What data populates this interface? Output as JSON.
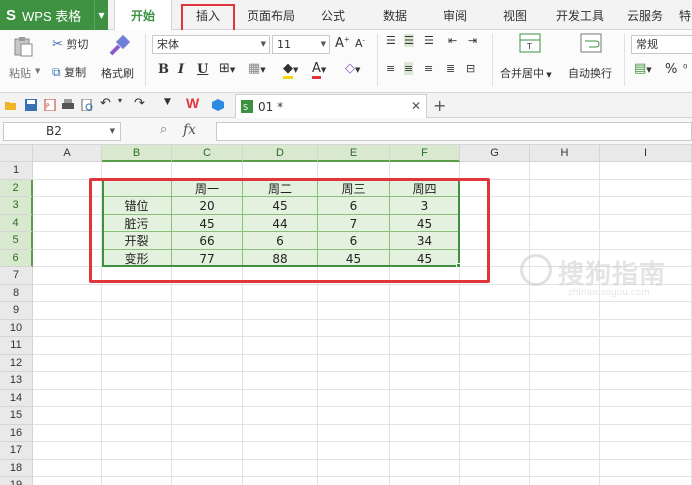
{
  "app": {
    "logo": "S",
    "title": "WPS 表格"
  },
  "ribbon_tabs": [
    "开始",
    "插入",
    "页面布局",
    "公式",
    "数据",
    "审阅",
    "视图",
    "开发工具",
    "云服务",
    "特"
  ],
  "ribbon": {
    "paste": "粘贴",
    "cut": "剪切",
    "copy": "复制",
    "format_painter": "格式刷",
    "font_name": "宋体",
    "font_size": "11",
    "bold": "B",
    "italic": "I",
    "underline": "U",
    "merge_center": "合并居中",
    "wrap_text": "自动换行",
    "number_format": "常规",
    "percent": "%"
  },
  "document_tab": {
    "name": "01 *"
  },
  "formula_bar": {
    "cell_ref": "B2",
    "fx": "fx",
    "value": ""
  },
  "columns": [
    "A",
    "B",
    "C",
    "D",
    "E",
    "F",
    "G",
    "H",
    "I"
  ],
  "rows": [
    "1",
    "2",
    "3",
    "4",
    "5",
    "6",
    "7",
    "8",
    "9",
    "10",
    "11",
    "12",
    "13",
    "14",
    "15",
    "16",
    "17",
    "18",
    "19"
  ],
  "table": {
    "headers": [
      "",
      "周一",
      "周二",
      "周三",
      "周四"
    ],
    "data": [
      [
        "错位",
        "20",
        "45",
        "6",
        "3"
      ],
      [
        "脏污",
        "45",
        "44",
        "7",
        "45"
      ],
      [
        "开裂",
        "66",
        "6",
        "6",
        "34"
      ],
      [
        "变形",
        "77",
        "88",
        "45",
        "45"
      ]
    ]
  },
  "watermark": {
    "text": "搜狗指南",
    "url": "zhinan.sogou.com"
  },
  "colors": {
    "brand_green": "#3d9140",
    "highlight_red": "#e2343b",
    "selection_fill": "#e3f1de"
  }
}
